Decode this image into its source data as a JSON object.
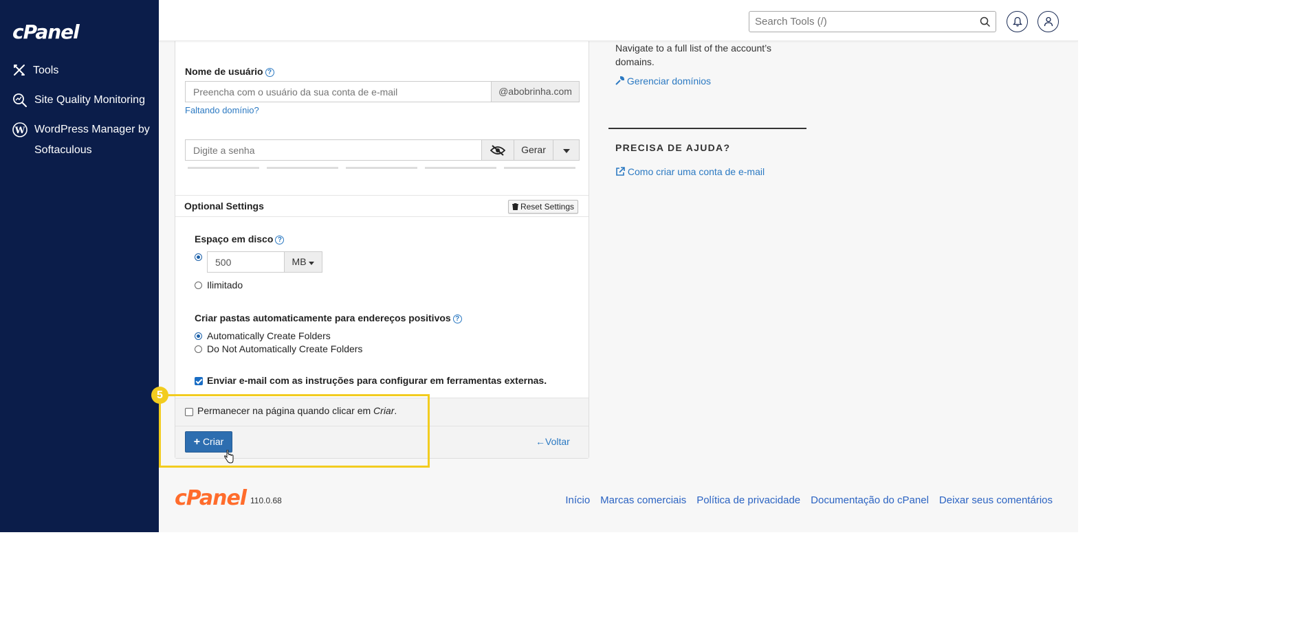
{
  "sidebar": {
    "logo": "cPanel",
    "items": [
      {
        "label": "Tools"
      },
      {
        "label": "Site Quality Monitoring"
      },
      {
        "label": "WordPress Manager by Softaculous"
      }
    ]
  },
  "topbar": {
    "search_placeholder": "Search Tools (/)"
  },
  "form": {
    "username_label": "Nome de usuário",
    "username_placeholder": "Preencha com o usuário da sua conta de e-mail",
    "domain_addon": "@abobrinha.com",
    "missing_domain_link": "Faltando domínio?",
    "password_placeholder": "Digite a senha",
    "generate_label": "Gerar",
    "optional_title": "Optional Settings",
    "reset_label": "Reset Settings",
    "disk_label": "Espaço em disco",
    "disk_value": "500",
    "disk_unit": "MB",
    "unlimited_label": "Ilimitado",
    "folders_label": "Criar pastas automaticamente para endereços positivos",
    "folders_option_auto": "Automatically Create Folders",
    "folders_option_none": "Do Not Automatically Create Folders",
    "send_instructions_label": "Enviar e-mail com as instruções para configurar em ferramentas externas.",
    "stay_on_page_label": "Permanecer na página quando clicar em ",
    "stay_on_page_italic": "Criar",
    "stay_on_page_end": ".",
    "create_label": "Criar",
    "back_label": "Voltar"
  },
  "right": {
    "domains_text": "Navigate to a full list of the account’s domains.",
    "manage_domains_link": "Gerenciar domínios",
    "help_title": "PRECISA DE AJUDA?",
    "help_link": "Como criar uma conta de e-mail"
  },
  "annotation": {
    "step": "5",
    "color": "#f2cc1f"
  },
  "footer": {
    "logo": "cPanel",
    "version": "110.0.68",
    "links": [
      "Início",
      "Marcas comerciais",
      "Política de privacidade",
      "Documentação do cPanel",
      "Deixar seus comentários"
    ]
  },
  "colors": {
    "sidebar_bg": "#0b1d4a",
    "accent": "#2d6eb0",
    "brand_orange": "#ff6c2c"
  }
}
